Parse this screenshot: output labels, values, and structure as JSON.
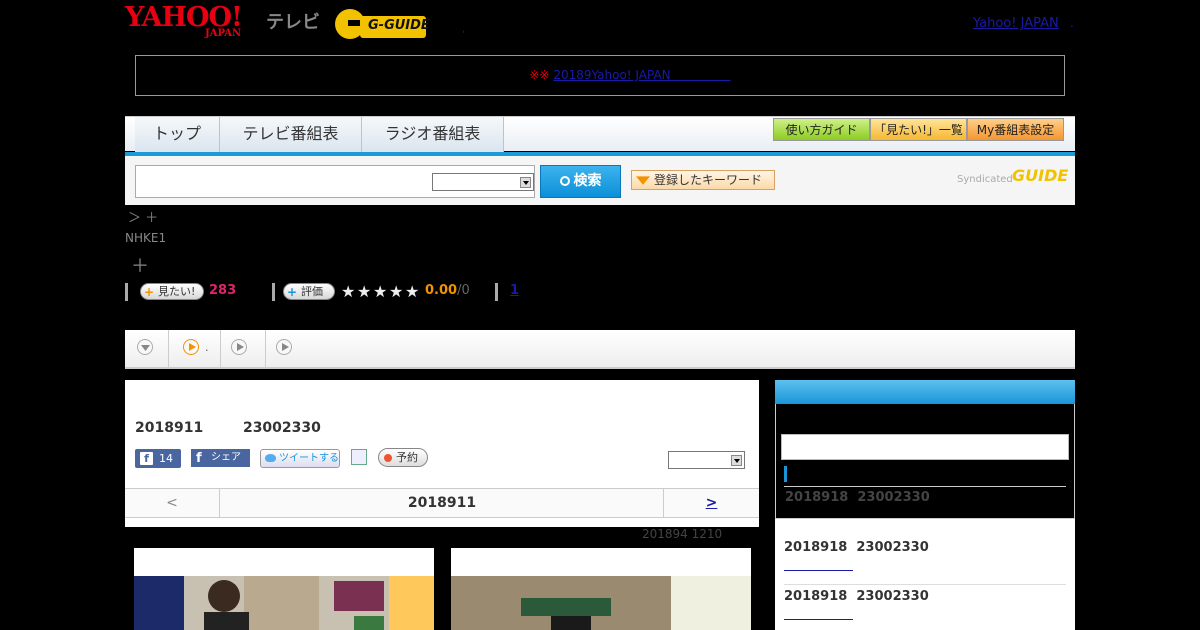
{
  "header": {
    "yahoo_logo": "YAHOO!",
    "yahoo_sub": "JAPAN",
    "tv_label": "テレビ",
    "gguide_logo": "G-GUIDE",
    "top_link": "Yahoo! JAPAN",
    "top_dot": ",",
    "top_dot2": "."
  },
  "notice": {
    "mark": "※※",
    "link_text": "20189Yahoo! JAPAN　　　　　"
  },
  "nav": {
    "tabs": [
      "トップ",
      "テレビ番組表",
      "ラジオ番組表"
    ],
    "buttons": [
      "使い方ガイド",
      "「見たい!」一覧",
      "My番組表設定"
    ]
  },
  "search": {
    "value": "",
    "select_value": "",
    "button_label": "検索",
    "keyword_button": "登録したキーワード",
    "syndicated_label": "Syndicated",
    "gguide_small": "GUIDE"
  },
  "breadcrumb": "＞ ＋",
  "channel": "NHKE1",
  "plus_icon": "＋",
  "stats": {
    "mitai_label": "見たい!",
    "mitai_count": "283",
    "hyouka_label": "評価",
    "rating": "0.00",
    "rating_count": "/0",
    "link_count": "1"
  },
  "tabs_row": {
    "tab2_suffix": "."
  },
  "program": {
    "date": "2018911",
    "time": "23002330",
    "fb_like_count": "14",
    "fb_share": "シェア",
    "tweet": "ツイートする",
    "reserve": "予約",
    "select_value": ""
  },
  "pager": {
    "prev": "<",
    "date": "2018911",
    "next": ">"
  },
  "small_date": "201894  1210",
  "sidebar": {
    "items": [
      {
        "date": "2018918",
        "time": "23002330"
      },
      {
        "date": "2018918",
        "time": "23002330"
      },
      {
        "date": "2018918",
        "time": "23002330"
      }
    ]
  },
  "colors": {
    "brand_red": "#e60012",
    "accent_blue": "#1a96d8",
    "gguide_yellow": "#f2c200"
  }
}
